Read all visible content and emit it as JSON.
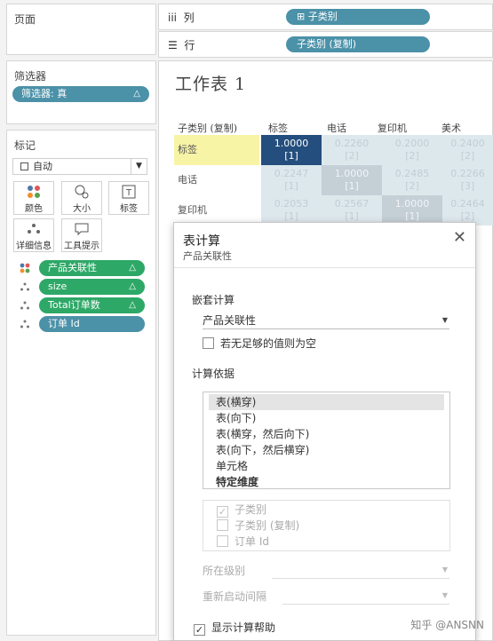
{
  "left": {
    "pages_label": "页面",
    "filters_label": "筛选器",
    "filter_pill": "筛选器: 真",
    "marks_label": "标记",
    "mark_type": "自动",
    "mark_buttons": {
      "color": "颜色",
      "size": "大小",
      "label": "标签",
      "detail": "详细信息",
      "tooltip": "工具提示"
    },
    "mark_pills": [
      "产品关联性",
      "size",
      "Total订单数",
      "订单 Id"
    ]
  },
  "shelves": {
    "columns_label": "列",
    "columns_pill": "子类别",
    "rows_label": "行",
    "rows_pill": "子类别 (复制)"
  },
  "worksheet": {
    "title": "工作表 1",
    "corner_header": "子类别 (复制)",
    "col_headers": [
      "标签",
      "电话",
      "复印机",
      "美术"
    ],
    "rows": [
      {
        "label": "标签",
        "cells": [
          {
            "v": "1.0000",
            "n": "[1]"
          },
          {
            "v": "0.2260",
            "n": "[2]"
          },
          {
            "v": "0.2000",
            "n": "[2]"
          },
          {
            "v": "0.2400",
            "n": "[2]"
          }
        ]
      },
      {
        "label": "电话",
        "cells": [
          {
            "v": "0.2247",
            "n": "[1]"
          },
          {
            "v": "1.0000",
            "n": "[1]"
          },
          {
            "v": "0.2485",
            "n": "[2]"
          },
          {
            "v": "0.2266",
            "n": "[3]"
          }
        ]
      },
      {
        "label": "复印机",
        "cells": [
          {
            "v": "0.2053",
            "n": "[1]"
          },
          {
            "v": "0.2567",
            "n": "[1]"
          },
          {
            "v": "1.0000",
            "n": "[1]"
          },
          {
            "v": "0.2464",
            "n": "[2]"
          }
        ]
      }
    ]
  },
  "dialog": {
    "title": "表计算",
    "subtitle": "产品关联性",
    "close": "✕",
    "nested_label": "嵌套计算",
    "nested_value": "产品关联性",
    "null_if_insufficient": "若无足够的值则为空",
    "compute_using_label": "计算依据",
    "compute_options": [
      "表(横穿)",
      "表(向下)",
      "表(横穿，然后向下)",
      "表(向下，然后横穿)",
      "单元格",
      "特定维度"
    ],
    "dimensions": [
      {
        "label": "子类别",
        "checked": true
      },
      {
        "label": "子类别 (复制)",
        "checked": false
      },
      {
        "label": "订单 Id",
        "checked": false
      }
    ],
    "at_level_label": "所在级别",
    "restart_every_label": "重新启动间隔",
    "show_help": "显示计算帮助",
    "show_help_checked": true
  },
  "watermark": "知乎 @ANSNN"
}
